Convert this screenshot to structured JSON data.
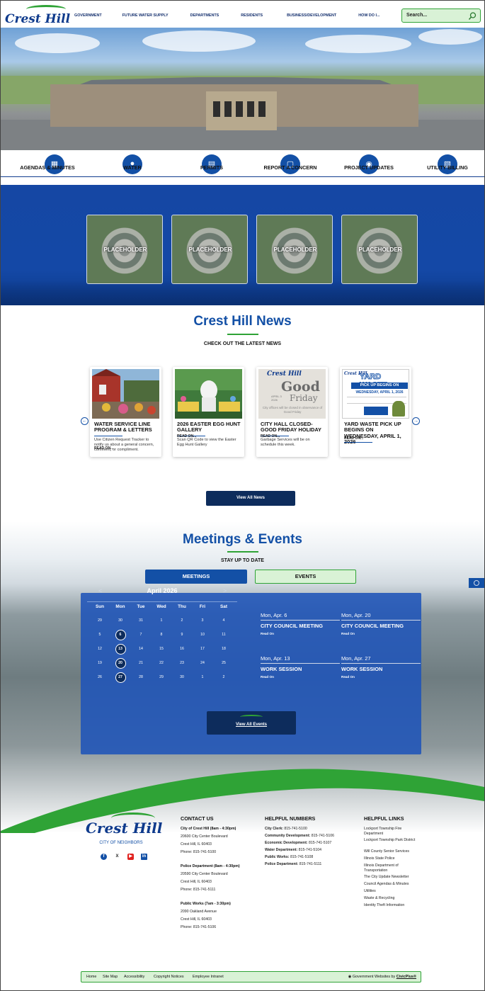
{
  "header": {
    "logo_text": "Crest Hill",
    "nav": [
      "GOVERNMENT",
      "FUTURE WATER SUPPLY",
      "DEPARTMENTS",
      "RESIDENTS",
      "BUSINESS/DEVELOPMENT",
      "HOW DO I..."
    ],
    "search_placeholder": "Search..."
  },
  "quick_links": [
    {
      "label": "AGENDAS & MINUTES",
      "icon": "calendar-icon"
    },
    {
      "label": "WATER",
      "icon": "water-drops-icon"
    },
    {
      "label": "PERMITS",
      "icon": "clipboard-icon"
    },
    {
      "label": "REPORT A CONCERN",
      "icon": "chat-bubble-icon"
    },
    {
      "label": "PROJECT UPDATES",
      "icon": "megaphone-icon"
    },
    {
      "label": "UTILITY BILLING",
      "icon": "bill-check-icon"
    }
  ],
  "placeholders": [
    "PLACEHOLDER",
    "PLACEHOLDER",
    "PLACEHOLDER",
    "PLACEHOLDER"
  ],
  "news": {
    "title": "Crest Hill News",
    "subtitle": "CHECK OUT THE LATEST NEWS",
    "view_all": "View All News",
    "cards": [
      {
        "title": "WATER SERVICE LINE PROGRAM & LETTERS",
        "desc": "Use Citizen Request Tracker to notify us about a general concern, comment, or compliment.",
        "more": "READ ON..."
      },
      {
        "title": "2026 EASTER EGG HUNT GALLERY",
        "desc": "Scan QR Code to view the Easter Egg Hunt Gallery",
        "more": "READ ON..."
      },
      {
        "title": "CITY HALL CLOSED- GOOD FRIDAY HOLIDAY",
        "desc": "Garbage Services will be on schedule this week.",
        "more": "READ ON..."
      },
      {
        "title": "YARD WASTE PICK UP BEGINS ON WEDNESDAY, APRIL 1, 2026",
        "desc": "",
        "more": "READ ON..."
      }
    ],
    "card3_image": {
      "brand": "Crest Hill",
      "big": "Good",
      "small": "Friday",
      "date": "APRIL 3 2026",
      "note": "City offices will be closed in observance of Good Friday"
    },
    "card4_image": {
      "brand": "Crest Hill",
      "head": "YARD WASTE",
      "band": "PICK UP BEGINS ON",
      "date": "WEDNESDAY, APRIL 1, 2026"
    }
  },
  "meetings": {
    "title": "Meetings & Events",
    "subtitle": "STAY UP TO DATE",
    "tab_meetings": "MEETINGS",
    "tab_events": "EVENTS",
    "calendar": {
      "month": "April 2026",
      "prev": "<",
      "next": ">",
      "dow": [
        "Sun",
        "Mon",
        "Tue",
        "Wed",
        "Thu",
        "Fri",
        "Sat"
      ],
      "weeks": [
        [
          "29",
          "30",
          "31",
          "1",
          "2",
          "3",
          "4"
        ],
        [
          "5",
          "6",
          "7",
          "8",
          "9",
          "10",
          "11"
        ],
        [
          "12",
          "13",
          "14",
          "15",
          "16",
          "17",
          "18"
        ],
        [
          "19",
          "20",
          "21",
          "22",
          "23",
          "24",
          "25"
        ],
        [
          "26",
          "27",
          "28",
          "29",
          "30",
          "1",
          "2"
        ]
      ],
      "highlighted": [
        "6",
        "13",
        "20",
        "27"
      ]
    },
    "events": [
      {
        "date": "Mon, Apr. 6",
        "title": "CITY COUNCIL MEETING",
        "more": "Read On"
      },
      {
        "date": "Mon, Apr. 20",
        "title": "CITY COUNCIL MEETING",
        "more": "Read On"
      },
      {
        "date": "Mon, Apr. 13",
        "title": "WORK SESSION",
        "more": "Read On"
      },
      {
        "date": "Mon, Apr. 27",
        "title": "WORK SESSION",
        "more": "Read On"
      }
    ],
    "view_all": "View All Events"
  },
  "footer": {
    "logo_text": "Crest Hill",
    "tagline": "CITY OF NEIGHBORS",
    "contact": {
      "heading": "CONTACT US",
      "blocks": [
        {
          "name": "City of Crest Hill (8am - 4:30pm)",
          "lines": [
            "20600 City Center Boulevard",
            "Crest Hill, IL 60403",
            "Phone: 815-741-5100"
          ]
        },
        {
          "name": "Police Department (8am - 4:30pm)",
          "lines": [
            "20590 City Center Boulevard",
            "Crest Hill, IL 60403",
            "Phone: 815-741-5111"
          ]
        },
        {
          "name": "Public Works (7am - 3:30pm)",
          "lines": [
            "2090 Oakland Avenue",
            "Crest Hill, IL 60403",
            "Phone: 815-741-5106"
          ]
        }
      ]
    },
    "numbers": {
      "heading": "HELPFUL NUMBERS",
      "items": [
        {
          "label": "City Clerk:",
          "value": "815-741-5100"
        },
        {
          "label": "Community Development:",
          "value": "815-741-5106"
        },
        {
          "label": "Economic Development:",
          "value": "815-741-5107"
        },
        {
          "label": "Water Department:",
          "value": "815-741-5104"
        },
        {
          "label": "Public Works:",
          "value": "815-741-5108"
        },
        {
          "label": "Police Department:",
          "value": "815-741-5111"
        }
      ]
    },
    "links": {
      "heading": "HELPFUL LINKS",
      "items": [
        "Lockport Township Fire Department",
        "Lockport Township Park District",
        "Will County Senior Services",
        "Illinois State Police",
        "Illinois Department of Transportation",
        "The City Update Newsletter",
        "Council Agendas & Minutes",
        "Utilities",
        "Waste & Recycling",
        "Identity Theft Information"
      ]
    },
    "bottom": {
      "links": [
        "Home",
        "Site Map",
        "Accessibility",
        "Copyright Notices",
        "Employee Intranet"
      ],
      "credit_prefix": "Government Websites by",
      "credit_link": "CivicPlus®"
    }
  },
  "colors": {
    "brand_blue": "#1350a6",
    "navy": "#0d2c5c",
    "green": "#2fa336",
    "light_green": "#d9f2d6"
  }
}
